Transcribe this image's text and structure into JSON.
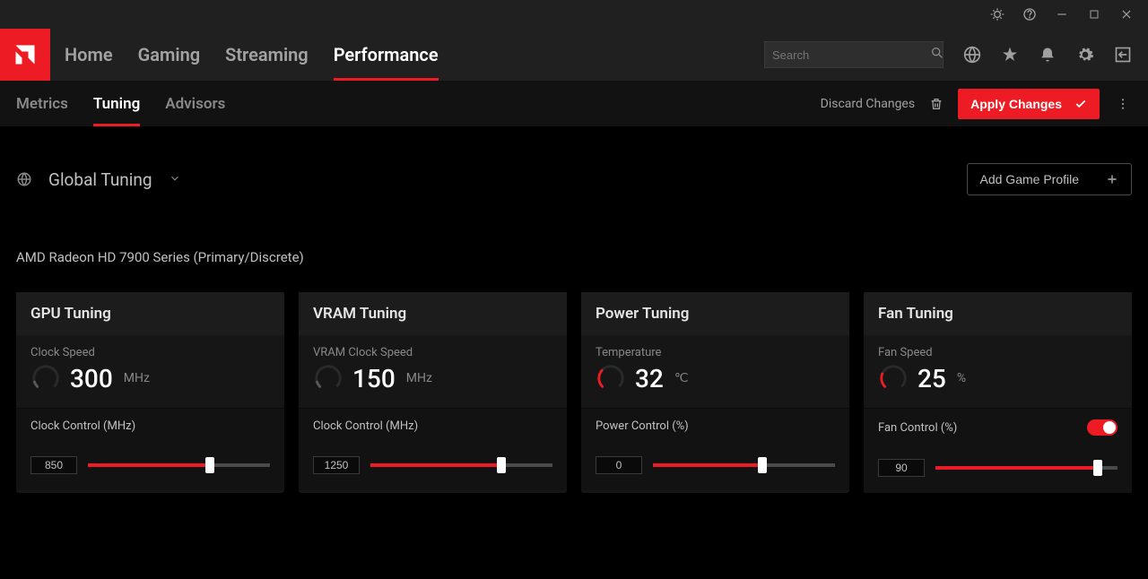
{
  "titlebar": {
    "icons": [
      "bug",
      "help",
      "minimize",
      "maximize",
      "close"
    ]
  },
  "nav": {
    "home": "Home",
    "gaming": "Gaming",
    "streaming": "Streaming",
    "performance": "Performance",
    "active": "performance"
  },
  "search": {
    "placeholder": "Search"
  },
  "subnav": {
    "metrics": "Metrics",
    "tuning": "Tuning",
    "advisors": "Advisors",
    "active": "tuning"
  },
  "actions": {
    "discard": "Discard Changes",
    "apply": "Apply Changes"
  },
  "scope": {
    "label": "Global Tuning",
    "add_profile": "Add Game Profile"
  },
  "gpu": "AMD Radeon HD 7900 Series (Primary/Discrete)",
  "cards": {
    "gpu": {
      "title": "GPU Tuning",
      "metric_label": "Clock Speed",
      "value": "300",
      "unit": "MHz",
      "gauge_pct": 10,
      "gauge_color": "#5a5a5a",
      "control_label": "Clock Control (MHz)",
      "input_value": "850",
      "fill_pct": 67
    },
    "vram": {
      "title": "VRAM Tuning",
      "metric_label": "VRAM Clock Speed",
      "value": "150",
      "unit": "MHz",
      "gauge_pct": 10,
      "gauge_color": "#5a5a5a",
      "control_label": "Clock Control (MHz)",
      "input_value": "1250",
      "fill_pct": 72
    },
    "power": {
      "title": "Power Tuning",
      "metric_label": "Temperature",
      "value": "32",
      "unit": "℃",
      "gauge_pct": 32,
      "gauge_color": "#ed1c24",
      "control_label": "Power Control (%)",
      "input_value": "0",
      "fill_pct": 60
    },
    "fan": {
      "title": "Fan Tuning",
      "metric_label": "Fan Speed",
      "value": "25",
      "unit": "%",
      "gauge_pct": 25,
      "gauge_color": "#ed1c24",
      "control_label": "Fan Control (%)",
      "input_value": "90",
      "fill_pct": 89,
      "has_toggle": true
    }
  }
}
